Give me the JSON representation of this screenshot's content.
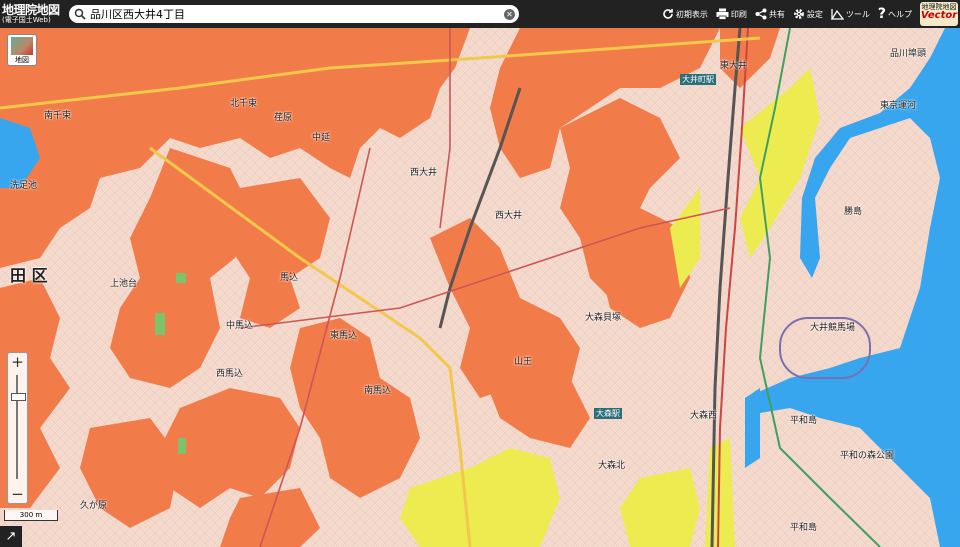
{
  "header": {
    "logo_title": "地理院地図",
    "logo_subtitle": "(電子国土Web)",
    "search_value": "品川区西大井4丁目",
    "tools": [
      {
        "label": "初期表示",
        "icon": "refresh-icon"
      },
      {
        "label": "印刷",
        "icon": "print-icon"
      },
      {
        "label": "共有",
        "icon": "share-icon"
      },
      {
        "label": "設定",
        "icon": "gear-icon"
      },
      {
        "label": "ツール",
        "icon": "measure-icon"
      },
      {
        "label": "ヘルプ",
        "icon": "help-icon"
      }
    ],
    "vector_top": "地理院地図",
    "vector_bottom": "Vector"
  },
  "controls": {
    "layer_button_label": "地図",
    "zoom_in": "+",
    "zoom_out": "−",
    "scale_label": "300 m",
    "corner_icon": "↗"
  },
  "map": {
    "colors": {
      "hazard_orange": "#f27b4a",
      "hazard_yellow": "#ecec50",
      "water": "#37a6ee",
      "base": "#f3d7cc",
      "green": "#7cc36a"
    },
    "labels": {
      "ward": "田 区",
      "nishioi_1": "西大井",
      "nishioi_2": "西大井",
      "nakanobu": "中延",
      "ebara": "荏原",
      "higashioi": "東大井",
      "oimachi_stn": "大井町駅",
      "omori_kaizuka": "大森貝塚",
      "omorikita": "大森北",
      "omori_stn": "大森駅",
      "sanno": "山王",
      "minamimagome": "南馬込",
      "nishimagome": "西馬込",
      "nakamagome": "中馬込",
      "magome": "馬込",
      "kamiikedai": "上池台",
      "minamisenzoku": "南千束",
      "heiwajima": "平和島",
      "heiwajima_2": "平和島",
      "katsushima": "勝島",
      "oi_keibajo": "大井競馬場",
      "tokyo_unga": "東京運河",
      "kita_senzoku": "北千束",
      "shinagawa_yako": "品川埠頭",
      "omori_nishi": "大森西",
      "higashi_magome": "東馬込",
      "senzokuike": "洗足池",
      "kugahara": "久が原",
      "heiwanomori": "平和の森公園"
    }
  }
}
